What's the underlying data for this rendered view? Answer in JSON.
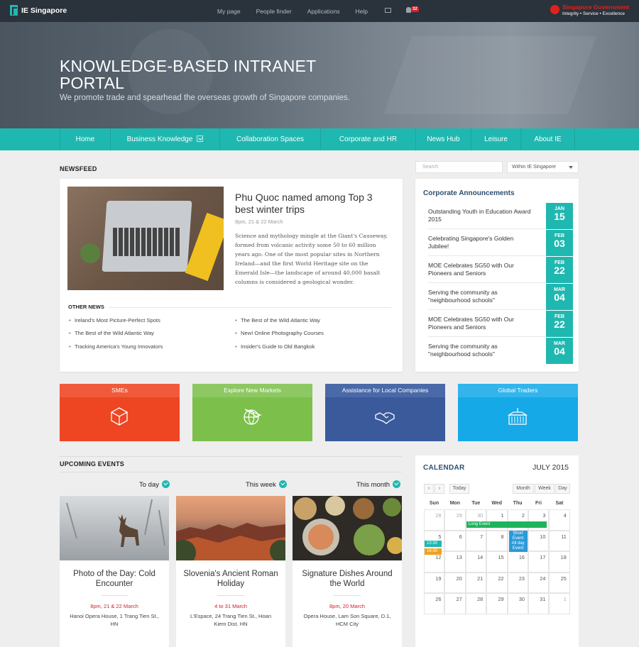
{
  "topbar": {
    "brand": "IE Singapore",
    "nav": [
      "My page",
      "People finder",
      "Applications",
      "Help"
    ],
    "notifications": "32",
    "gov_name": "Singapore Government",
    "gov_tagline": "Integrity • Service • Excellence"
  },
  "hero": {
    "title": "KNOWLEDGE-BASED INTRANET PORTAL",
    "subtitle": "We promote trade and spearhead the overseas growth of Singapore companies."
  },
  "mainnav": [
    "Home",
    "Business Knowledge",
    "Collaboration Spaces",
    "Corporate and HR",
    "News Hub",
    "Leisure",
    "About IE"
  ],
  "newsfeed": {
    "heading": "NEWSFEED",
    "title": "Phu Quoc named among Top 3 best winter trips",
    "date": "8pm, 21 & 22 March",
    "body": "Science and mythology mingle at the Giant's Causeway, formed from volcanic activity some 50 to 60 million years ago. One of the most popular sites in Northern Ireland—and the first World Heritage site on the Emerald Isle—the landscape of around 40,000 basalt columns is considered a geological wonder.",
    "other_heading": "OTHER NEWS",
    "other_left": [
      "Ireland's Most Picture-Perfect Spots",
      "The Best of the Wild Atlantic Way",
      "Tracking America's Young Innovators"
    ],
    "other_right": [
      "The Best of the Wild Atlantic Way",
      "New! Online Photography Courses",
      "Insider's Guide to Old Bangkok"
    ]
  },
  "search": {
    "placeholder": "Search",
    "scope": "Within IE Singapore"
  },
  "announcements": {
    "heading": "Corporate Announcements",
    "items": [
      {
        "text": "Outstanding Youth in Education Award 2015",
        "month": "JAN",
        "day": "15"
      },
      {
        "text": "Celebrating Singapore's Golden Jubilee!",
        "month": "FEB",
        "day": "03"
      },
      {
        "text": "MOE Celebrates SG50 with Our Pioneers and Seniors",
        "month": "FEB",
        "day": "22"
      },
      {
        "text": "Serving the community as \"neighbourhood schools\"",
        "month": "MAR",
        "day": "04"
      },
      {
        "text": "MOE Celebrates SG50 with Our Pioneers and Seniors",
        "month": "FEB",
        "day": "22"
      },
      {
        "text": "Serving the community as \"neighbourhood schools\"",
        "month": "MAR",
        "day": "04"
      }
    ]
  },
  "tiles": [
    {
      "label": "SMEs",
      "color": "#ee4523",
      "header": "#f05a3a"
    },
    {
      "label": "Explore New Markets",
      "color": "#7cc04b",
      "header": "#8dc862"
    },
    {
      "label": "Assistance for Local Companies",
      "color": "#3a5a9b",
      "header": "#4a69a8"
    },
    {
      "label": "Global Traders",
      "color": "#16a9e8",
      "header": "#33b5ec"
    }
  ],
  "events": {
    "heading": "UPCOMING EVENTS",
    "tabs": [
      "To day",
      "This week",
      "This month"
    ],
    "cards": [
      {
        "title": "Photo of the Day: Cold Encounter",
        "date": "8pm, 21 & 22 March",
        "place": "Hanoi Opera House, 1 Trang Tien St., HN"
      },
      {
        "title": "Slovenia's Ancient Roman Holiday",
        "date": "4 to 31 March",
        "place": "L'Espace, 24 Trang Tien St., Hoan Kiem Dist. HN"
      },
      {
        "title": "Signature Dishes Around the World",
        "date": "8pm, 20 March",
        "place": "Opera House, Lam Son Square, D.1, HCM City"
      }
    ]
  },
  "calendar": {
    "heading": "CALENDAR",
    "month": "JULY 2015",
    "today": "Today",
    "views": [
      "Month",
      "Week",
      "Day"
    ],
    "days": [
      "Sun",
      "Mon",
      "Tue",
      "Wed",
      "Thu",
      "Fri",
      "Sat"
    ],
    "weeks": [
      [
        "28",
        "29",
        "30",
        "1",
        "2",
        "3",
        "4"
      ],
      [
        "5",
        "6",
        "7",
        "8",
        "9",
        "10",
        "11"
      ],
      [
        "12",
        "13",
        "14",
        "15",
        "16",
        "17",
        "18"
      ],
      [
        "19",
        "20",
        "21",
        "22",
        "23",
        "24",
        "25"
      ],
      [
        "26",
        "27",
        "28",
        "29",
        "30",
        "31",
        "1"
      ]
    ],
    "events": {
      "long": "Long Event",
      "short": "Short Event",
      "t1": "10:30",
      "t2": "16:30",
      "allday": "All day Event"
    }
  }
}
